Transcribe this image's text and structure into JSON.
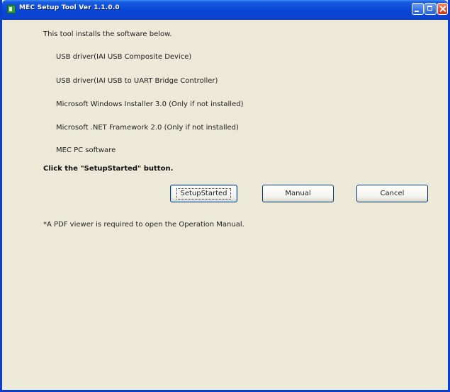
{
  "window": {
    "title": "MEC Setup Tool Ver 1.1.0.0"
  },
  "content": {
    "intro": "This tool installs the software below.",
    "items": [
      "USB driver(IAI USB Composite Device)",
      "USB driver(IAI USB to UART Bridge Controller)",
      "Microsoft Windows Installer 3.0 (Only if not installed)",
      "Microsoft .NET Framework 2.0 (Only if not installed)",
      "MEC PC software"
    ],
    "instruction": "Click the \"SetupStarted\" button.",
    "note": "*A PDF viewer is required to open the Operation Manual."
  },
  "buttons": {
    "setup": "SetupStarted",
    "manual": "Manual",
    "cancel": "Cancel"
  },
  "icons": {
    "app": "app-icon",
    "minimize": "minimize-icon",
    "maximize": "maximize-icon",
    "close": "close-icon"
  }
}
